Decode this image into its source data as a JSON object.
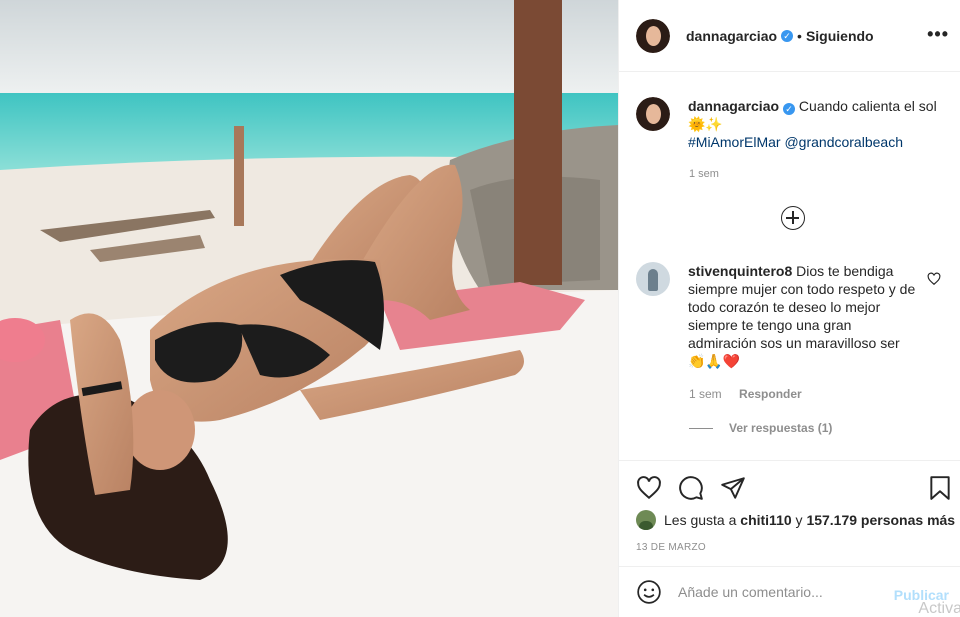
{
  "post": {
    "username": "dannagarciao",
    "verified_mark": "✓",
    "separator": "•",
    "follow_status": "Siguiendo",
    "more_label": "•••"
  },
  "caption": {
    "username": "dannagarciao",
    "text": "Cuando calienta el sol",
    "emojis": "🌞✨",
    "hashtag": "#MiAmorElMar",
    "mention": "@grandcoralbeach",
    "time": "1 sem"
  },
  "comment": {
    "username": "stivenquintero8",
    "text": "Dios te bendiga siempre mujer con todo respeto y de todo corazón te deseo lo mejor siempre te tengo una gran admiración sos un maravilloso ser",
    "emojis": "👏🙏❤️",
    "time": "1 sem",
    "reply_label": "Responder",
    "view_replies": "Ver respuestas (1)"
  },
  "likes": {
    "prefix": "Les gusta a",
    "user": "chiti110",
    "middle": "y",
    "others": "157.179 personas más"
  },
  "date": "13 DE MARZO",
  "add_comment": {
    "placeholder": "Añade un comentario...",
    "publish_label": "Publicar"
  },
  "watermark": "Activa",
  "icons": [
    "heart-icon",
    "comment-icon",
    "share-icon",
    "bookmark-icon",
    "add-icon",
    "emoji-icon",
    "more-icon"
  ],
  "colors": {
    "link": "#00376b",
    "verified": "#3897f0",
    "publish": "#b2dffc",
    "muted": "#8e8e8e"
  }
}
